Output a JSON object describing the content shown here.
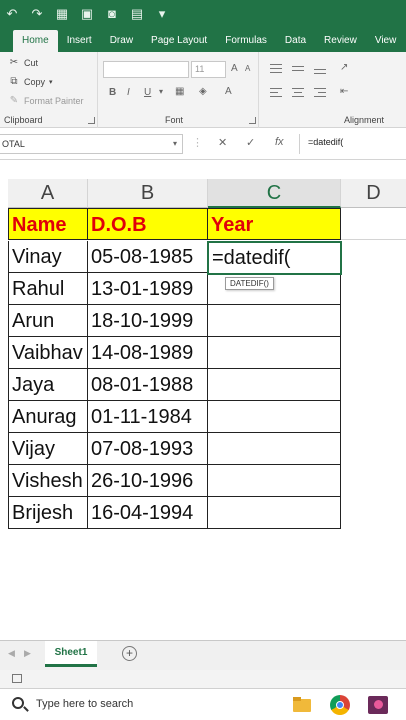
{
  "ribbon": {
    "tabs": [
      "Home",
      "Insert",
      "Draw",
      "Page Layout",
      "Formulas",
      "Data",
      "Review",
      "View"
    ],
    "active_tab": "Home",
    "clipboard": {
      "cut": "Cut",
      "copy": "Copy",
      "format_painter": "Format Painter",
      "label": "Clipboard"
    },
    "font": {
      "size": "11",
      "label": "Font",
      "bold": "B",
      "italic": "I",
      "underline": "U"
    },
    "alignment": {
      "label": "Alignment"
    }
  },
  "formula_bar": {
    "name_box": "OTAL",
    "formula": "=datedif("
  },
  "grid": {
    "columns": [
      "A",
      "B",
      "C",
      "D"
    ],
    "headers": [
      "Name",
      "D.O.B",
      "Year"
    ],
    "rows": [
      [
        "Vinay",
        "05-08-1985"
      ],
      [
        "Rahul",
        "13-01-1989"
      ],
      [
        "Arun",
        "18-10-1999"
      ],
      [
        "Vaibhav",
        "14-08-1989"
      ],
      [
        "Jaya",
        "08-01-1988"
      ],
      [
        "Anurag",
        "01-11-1984"
      ],
      [
        "Vijay",
        "07-08-1993"
      ],
      [
        "Vishesh",
        "26-10-1996"
      ],
      [
        "Brijesh",
        "16-04-1994"
      ]
    ],
    "active_cell_value": "=datedif(",
    "tooltip": "DATEDIF()"
  },
  "sheets": {
    "tabs": [
      "Sheet1"
    ],
    "add": "+"
  },
  "taskbar": {
    "search_placeholder": "Type here to search"
  },
  "colors": {
    "excel_green": "#217346",
    "header_fill": "#ffff00",
    "header_text": "#e0000a"
  }
}
